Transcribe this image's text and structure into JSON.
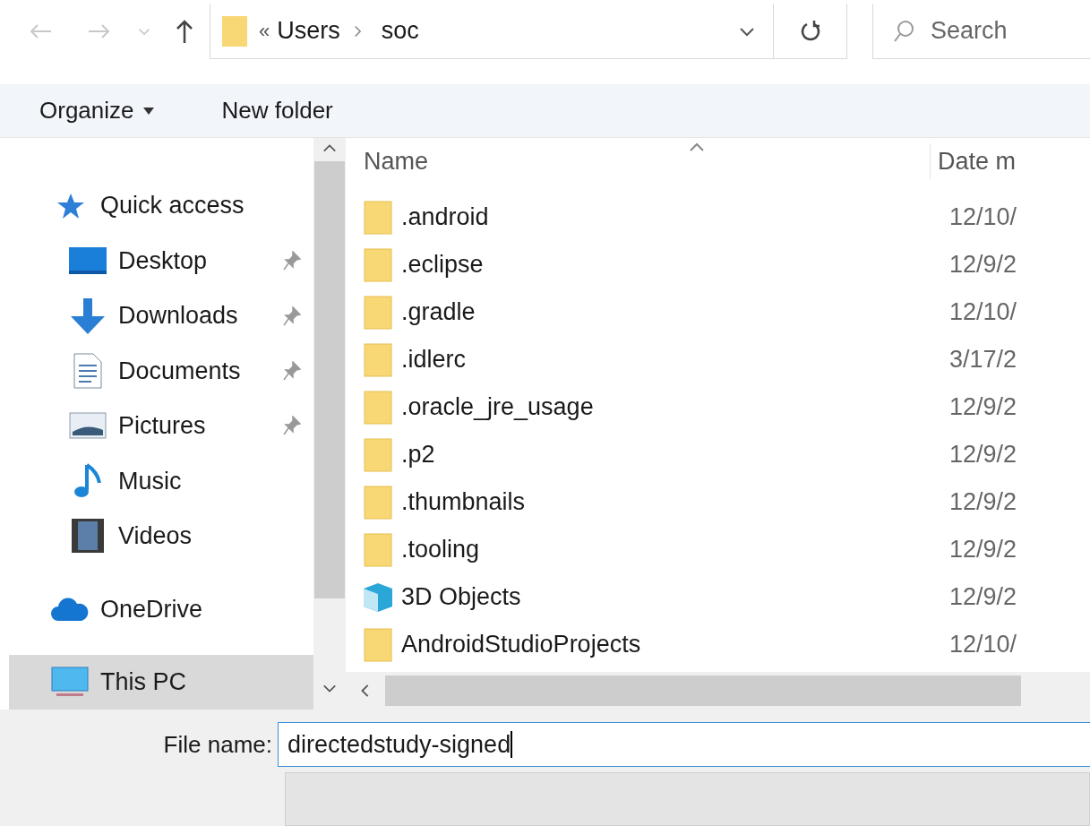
{
  "address_bar": {
    "overflow": "«",
    "path": [
      "Users",
      "soc"
    ]
  },
  "search": {
    "placeholder": "Search"
  },
  "toolbar": {
    "organize": "Organize",
    "new_folder": "New folder"
  },
  "sidebar": {
    "items": [
      {
        "label": "Quick access",
        "kind": "star",
        "pinned": false,
        "selected": false,
        "children": [
          {
            "label": "Desktop",
            "kind": "desktop",
            "pinned": true,
            "selected": false
          },
          {
            "label": "Downloads",
            "kind": "download",
            "pinned": true,
            "selected": false
          },
          {
            "label": "Documents",
            "kind": "document",
            "pinned": true,
            "selected": false
          },
          {
            "label": "Pictures",
            "kind": "picture",
            "pinned": true,
            "selected": false
          },
          {
            "label": "Music",
            "kind": "music",
            "pinned": false,
            "selected": false
          },
          {
            "label": "Videos",
            "kind": "video",
            "pinned": false,
            "selected": false
          }
        ]
      },
      {
        "label": "OneDrive",
        "kind": "cloud",
        "pinned": false,
        "selected": false
      },
      {
        "label": "This PC",
        "kind": "pc",
        "pinned": false,
        "selected": true
      }
    ]
  },
  "table": {
    "columns": [
      "Name",
      "Date m"
    ],
    "rows": [
      {
        "name": ".android",
        "date": "12/10/",
        "kind": "folder"
      },
      {
        "name": ".eclipse",
        "date": "12/9/2",
        "kind": "folder"
      },
      {
        "name": ".gradle",
        "date": "12/10/",
        "kind": "folder"
      },
      {
        "name": ".idlerc",
        "date": "3/17/2",
        "kind": "folder"
      },
      {
        "name": ".oracle_jre_usage",
        "date": "12/9/2",
        "kind": "folder"
      },
      {
        "name": ".p2",
        "date": "12/9/2",
        "kind": "folder"
      },
      {
        "name": ".thumbnails",
        "date": "12/9/2",
        "kind": "folder"
      },
      {
        "name": ".tooling",
        "date": "12/9/2",
        "kind": "folder"
      },
      {
        "name": "3D Objects",
        "date": "12/9/2",
        "kind": "objects"
      },
      {
        "name": "AndroidStudioProjects",
        "date": "12/10/",
        "kind": "folder"
      }
    ]
  },
  "file_name": {
    "label": "File name:",
    "value": "directedstudy-signed"
  }
}
